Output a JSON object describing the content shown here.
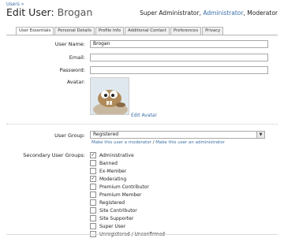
{
  "breadcrumb": "Users »",
  "title": {
    "prefix": "Edit User:",
    "username": "Brogan"
  },
  "roles": {
    "a": "Super Administrator",
    "sep1": ", ",
    "b": "Administrator",
    "sep2": ", ",
    "c": "Moderator"
  },
  "tabs": [
    {
      "label": "User Essentials",
      "active": true
    },
    {
      "label": "Personal Details",
      "active": false
    },
    {
      "label": "Profile Info",
      "active": false
    },
    {
      "label": "Additional Contact",
      "active": false
    },
    {
      "label": "Preferences",
      "active": false
    },
    {
      "label": "Privacy",
      "active": false
    }
  ],
  "form": {
    "username_label": "User Name:",
    "username_value": "Brogan",
    "email_label": "Email:",
    "email_value": "",
    "password_label": "Password:",
    "password_value": "",
    "avatar_label": "Avatar:",
    "edit_avatar": "Edit Avatar"
  },
  "user_group": {
    "label": "User Group:",
    "selected": "Registered",
    "link_moderator": "Make this user a moderator",
    "link_sep": " / ",
    "link_admin": "Make this user an administrator"
  },
  "secondary_groups": {
    "label": "Secondary User Groups:",
    "items": [
      {
        "label": "Administrative",
        "checked": true
      },
      {
        "label": "Banned",
        "checked": false
      },
      {
        "label": "Ex-Member",
        "checked": false
      },
      {
        "label": "Moderating",
        "checked": true
      },
      {
        "label": "Premium Contributor",
        "checked": false
      },
      {
        "label": "Premium Member",
        "checked": false
      },
      {
        "label": "Registered",
        "checked": false
      },
      {
        "label": "Site Contributor",
        "checked": false
      },
      {
        "label": "Site Supporter",
        "checked": false
      },
      {
        "label": "Super User",
        "checked": false
      },
      {
        "label": "Unregistered / Unconfirmed",
        "checked": false
      }
    ]
  },
  "colors": {
    "link": "#3a6ea5",
    "border": "#a9a9a9"
  },
  "icons": {
    "dropdown": "chevron-down-icon",
    "checkbox_mark": "check-icon"
  }
}
